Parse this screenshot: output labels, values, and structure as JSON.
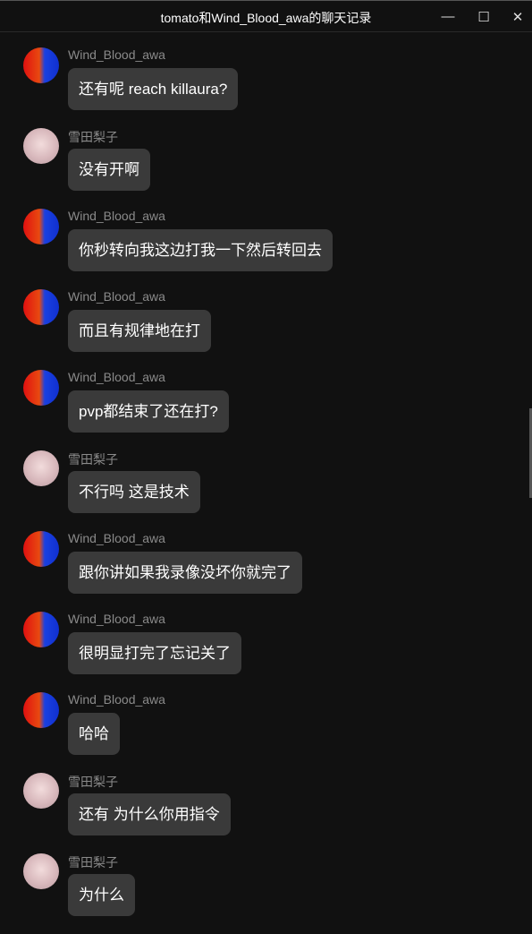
{
  "window": {
    "title": "tomato和Wind_Blood_awa的聊天记录",
    "minimize": "—",
    "maximize": "☐",
    "close": "✕"
  },
  "messages": [
    {
      "sender": "Wind_Blood_awa",
      "avatar": "wind",
      "text": "还有呢 reach killaura?"
    },
    {
      "sender": "雪田梨子",
      "avatar": "xue",
      "text": "没有开啊"
    },
    {
      "sender": "Wind_Blood_awa",
      "avatar": "wind",
      "text": "你秒转向我这边打我一下然后转回去"
    },
    {
      "sender": "Wind_Blood_awa",
      "avatar": "wind",
      "text": "而且有规律地在打"
    },
    {
      "sender": "Wind_Blood_awa",
      "avatar": "wind",
      "text": "pvp都结束了还在打?"
    },
    {
      "sender": "雪田梨子",
      "avatar": "xue",
      "text": "不行吗 这是技术"
    },
    {
      "sender": "Wind_Blood_awa",
      "avatar": "wind",
      "text": "跟你讲如果我录像没坏你就完了"
    },
    {
      "sender": "Wind_Blood_awa",
      "avatar": "wind",
      "text": "很明显打完了忘记关了"
    },
    {
      "sender": "Wind_Blood_awa",
      "avatar": "wind",
      "text": "哈哈"
    },
    {
      "sender": "雪田梨子",
      "avatar": "xue",
      "text": "还有 为什么你用指令"
    },
    {
      "sender": "雪田梨子",
      "avatar": "xue",
      "text": "为什么"
    }
  ]
}
